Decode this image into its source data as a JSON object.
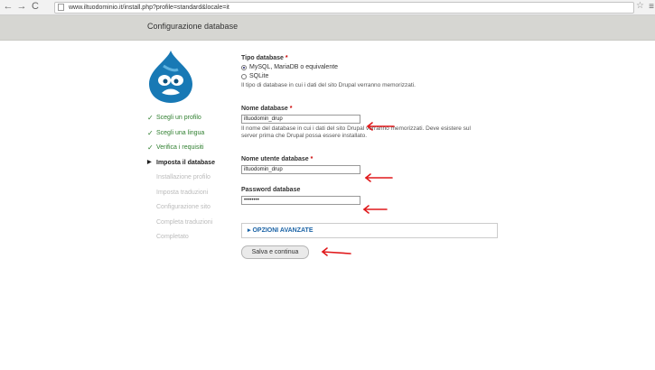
{
  "browser": {
    "url": "www.iltuodominio.it/install.php?profile=standard&locale=it",
    "back_glyph": "←",
    "forward_glyph": "→",
    "reload_glyph": "C",
    "star_glyph": "☆",
    "menu_glyph": "≡"
  },
  "page": {
    "title": "Configurazione database"
  },
  "steps": [
    {
      "label": "Scegli un profilo",
      "state": "done"
    },
    {
      "label": "Scegli una lingua",
      "state": "done"
    },
    {
      "label": "Verifica i requisiti",
      "state": "done"
    },
    {
      "label": "Imposta il database",
      "state": "active"
    },
    {
      "label": "Installazione profilo",
      "state": "todo"
    },
    {
      "label": "Imposta traduzioni",
      "state": "todo"
    },
    {
      "label": "Configurazione sito",
      "state": "todo"
    },
    {
      "label": "Completa traduzioni",
      "state": "todo"
    },
    {
      "label": "Completato",
      "state": "todo"
    }
  ],
  "form": {
    "db_type": {
      "label": "Tipo database",
      "required": "*",
      "options": [
        "MySQL, MariaDB o equivalente",
        "SQLite"
      ],
      "selected": "MySQL, MariaDB o equivalente",
      "description": "Il tipo di database in cui i dati del sito Drupal verranno memorizzati."
    },
    "db_name": {
      "label": "Nome database",
      "required": "*",
      "value": "iltuodomin_drup",
      "description_line1": "Il nome del database in cui i dati del sito Drupal verranno memorizzati. Deve esistere sul",
      "description_line2": "server prima che Drupal possa essere installato."
    },
    "db_user": {
      "label": "Nome utente database",
      "required": "*",
      "value": "iltuodomin_drup"
    },
    "db_pass": {
      "label": "Password database",
      "value": "••••••••"
    },
    "advanced": {
      "label": "OPZIONI AVANZATE"
    },
    "submit": {
      "label": "Salva e continua"
    }
  },
  "colors": {
    "annotation_arrow": "#e0191b",
    "link": "#1c64a6",
    "done_step": "#2f7f2f"
  },
  "icons": {
    "check": "✓",
    "current": "▶",
    "logo": "drupal-drop-logo"
  }
}
